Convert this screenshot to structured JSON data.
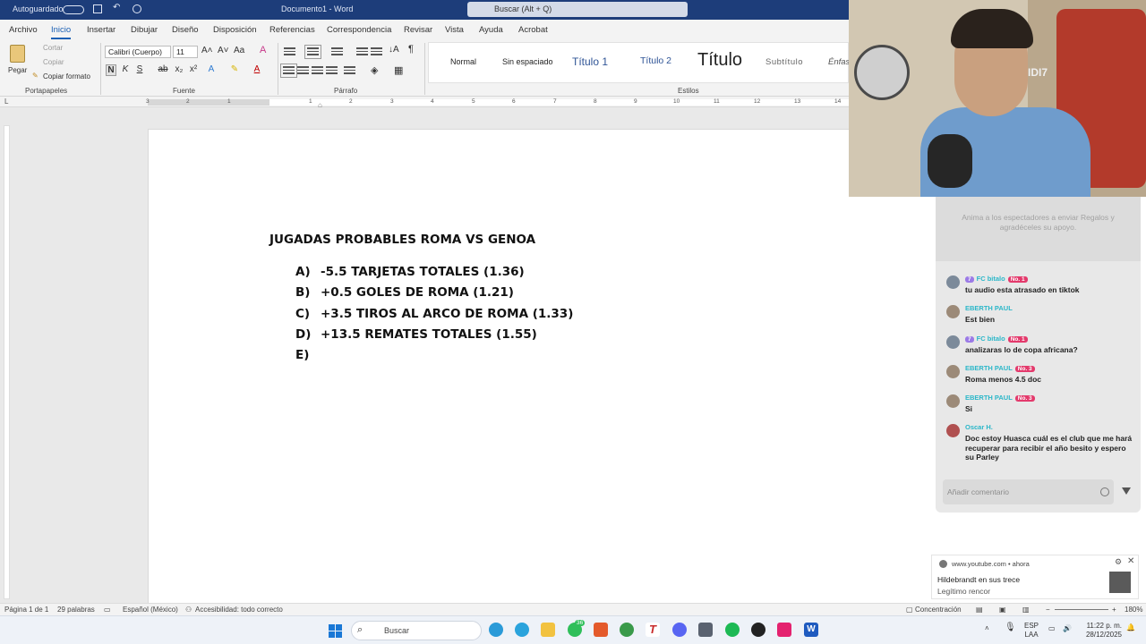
{
  "titlebar": {
    "autosave": "Autoguardado",
    "doc_title": "Documento1 - Word",
    "search_placeholder": "Buscar (Alt + Q)"
  },
  "menu": [
    "Archivo",
    "Inicio",
    "Insertar",
    "Dibujar",
    "Diseño",
    "Disposición",
    "Referencias",
    "Correspondencia",
    "Revisar",
    "Vista",
    "Ayuda",
    "Acrobat"
  ],
  "ribbon": {
    "clipboard": {
      "paste": "Pegar",
      "cut": "Cortar",
      "copy": "Copiar",
      "format_painter": "Copiar formato",
      "label": "Portapapeles"
    },
    "font": {
      "family": "Calibri (Cuerpo)",
      "size": "11",
      "bold": "N",
      "italic": "K",
      "underline": "S",
      "label": "Fuente"
    },
    "paragraph": {
      "label": "Párrafo"
    },
    "styles": {
      "items": [
        "Normal",
        "Sin espaciado",
        "Título 1",
        "Título 2",
        "Título",
        "Subtítulo",
        "Énfas"
      ],
      "label": "Estilos"
    }
  },
  "ruler_numbers": [
    "3",
    "2",
    "1",
    "1",
    "2",
    "3",
    "4",
    "5",
    "6",
    "7",
    "8",
    "9",
    "10",
    "11",
    "12",
    "13",
    "14"
  ],
  "document": {
    "title": "JUGADAS PROBABLES ROMA VS GENOA",
    "options": [
      {
        "letter": "A)",
        "text": "-5.5 TARJETAS TOTALES (1.36)"
      },
      {
        "letter": "B)",
        "text": "+0.5 GOLES DE ROMA (1.21)"
      },
      {
        "letter": "C)",
        "text": "+3.5 TIROS AL ARCO DE ROMA (1.33)"
      },
      {
        "letter": "D)",
        "text": "+13.5 REMATES TOTALES (1.55)"
      },
      {
        "letter": "E)",
        "text": ""
      }
    ]
  },
  "statusbar": {
    "page": "Página 1 de 1",
    "words": "29 palabras",
    "language": "Español (México)",
    "accessibility": "Accesibilidad: todo correcto",
    "focus": "Concentración",
    "zoom": "180%"
  },
  "chat": {
    "gift_prompt": "Anima a los espectadores a enviar Regalos y agradéceles su apoyo.",
    "messages": [
      {
        "level": "7",
        "user": "FC bitalo",
        "badge": "No. 1",
        "text": "tu audio esta atrasado en tiktok"
      },
      {
        "level": "",
        "user": "EBERTH PAUL",
        "badge": "",
        "text": "Est bien"
      },
      {
        "level": "7",
        "user": "FC bitalo",
        "badge": "No. 1",
        "text": "analizaras lo de copa africana?"
      },
      {
        "level": "",
        "user": "EBERTH PAUL",
        "badge": "No. 3",
        "text": "Roma menos 4.5 doc"
      },
      {
        "level": "",
        "user": "EBERTH PAUL",
        "badge": "No. 3",
        "text": "Si"
      },
      {
        "level": "",
        "user": "Oscar H.",
        "badge": "",
        "text": "Doc estoy Huasca cuál es el club que me hará recuperar para recibir el año besito y espero su Parley"
      }
    ],
    "input_placeholder": "Añadir comentario"
  },
  "notification": {
    "source": "www.youtube.com",
    "time": "ahora",
    "title": "Hildebrandt en sus trece",
    "subtitle": "Legítimo rencor"
  },
  "taskbar": {
    "search": "Buscar",
    "badge_count": "36",
    "lang_top": "ESP",
    "lang_bottom": "LAA",
    "time": "11:22 p. m.",
    "date": "28/12/2025"
  },
  "webcam_overlay_text": "IDI7"
}
